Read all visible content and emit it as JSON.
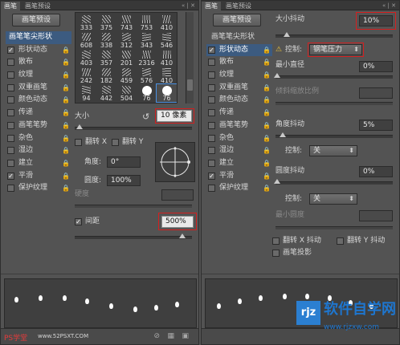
{
  "left": {
    "tabs": [
      "画笔",
      "画笔预设"
    ],
    "win_ctrl": "« | ✕",
    "presets_button": "画笔预设",
    "list_header": "画笔笔尖形状",
    "list": [
      {
        "label": "形状动态",
        "checked": true,
        "lock": true
      },
      {
        "label": "散布",
        "checked": false,
        "lock": true
      },
      {
        "label": "纹理",
        "checked": false,
        "lock": true
      },
      {
        "label": "双重画笔",
        "checked": false,
        "lock": true
      },
      {
        "label": "颜色动态",
        "checked": false,
        "lock": true
      },
      {
        "label": "传递",
        "checked": false,
        "lock": true
      },
      {
        "label": "画笔笔势",
        "checked": false,
        "lock": true
      },
      {
        "label": "杂色",
        "checked": false,
        "lock": true
      },
      {
        "label": "湿边",
        "checked": false,
        "lock": true
      },
      {
        "label": "建立",
        "checked": false,
        "lock": true
      },
      {
        "label": "平滑",
        "checked": true,
        "lock": true
      },
      {
        "label": "保护纹理",
        "checked": false,
        "lock": true
      }
    ],
    "brushes": [
      "333",
      "375",
      "743",
      "753",
      "410",
      "608",
      "338",
      "312",
      "343",
      "546",
      "403",
      "357",
      "201",
      "2316",
      "410",
      "242",
      "182",
      "459",
      "576",
      "410",
      "94",
      "442",
      "504",
      "76",
      "76"
    ],
    "size_label": "大小",
    "size_value": "10 像素",
    "flip_x": "翻转 X",
    "flip_y": "翻转 Y",
    "angle_label": "角度:",
    "angle_value": "0°",
    "roundness_label": "圆度:",
    "roundness_value": "100%",
    "hardness_label": "硬度",
    "spacing_label": "间距",
    "spacing_value": "500%",
    "watermark_left": "PS学堂",
    "watermark_url": "www.52PSXT.COM"
  },
  "right": {
    "tabs": [
      "画笔",
      "画笔预设"
    ],
    "win_ctrl": "« | ✕",
    "presets_button": "画笔预设",
    "list_header": "画笔笔尖形状",
    "list": [
      {
        "label": "形状动态",
        "checked": true,
        "lock": true
      },
      {
        "label": "散布",
        "checked": false,
        "lock": true
      },
      {
        "label": "纹理",
        "checked": false,
        "lock": true
      },
      {
        "label": "双重画笔",
        "checked": false,
        "lock": true
      },
      {
        "label": "颜色动态",
        "checked": false,
        "lock": true
      },
      {
        "label": "传递",
        "checked": false,
        "lock": true
      },
      {
        "label": "画笔笔势",
        "checked": false,
        "lock": true
      },
      {
        "label": "杂色",
        "checked": false,
        "lock": true
      },
      {
        "label": "湿边",
        "checked": false,
        "lock": true
      },
      {
        "label": "建立",
        "checked": false,
        "lock": true
      },
      {
        "label": "平滑",
        "checked": true,
        "lock": true
      },
      {
        "label": "保护纹理",
        "checked": false,
        "lock": true
      }
    ],
    "size_jitter_label": "大小抖动",
    "size_jitter_value": "10%",
    "control_label": "控制:",
    "control_value": "钢笔压力",
    "min_diameter_label": "最小直径",
    "min_diameter_value": "0%",
    "tilt_scale_label": "倾斜缩放比例",
    "angle_jitter_label": "角度抖动",
    "angle_jitter_value": "5%",
    "control2_label": "控制:",
    "control2_value": "关",
    "roundness_jitter_label": "圆度抖动",
    "roundness_jitter_value": "0%",
    "control3_label": "控制:",
    "control3_value": "关",
    "min_roundness_label": "最小圆度",
    "flip_x_jitter": "翻转 X 抖动",
    "flip_y_jitter": "翻转 Y 抖动",
    "brush_projection": "画笔投影",
    "watermark_text": "软件自学网",
    "watermark_url": "www.rjzxw.com"
  },
  "colors": {
    "accent_red": "#d51f1f",
    "selection_blue": "#3c5b80",
    "panel_bg": "#535353"
  }
}
